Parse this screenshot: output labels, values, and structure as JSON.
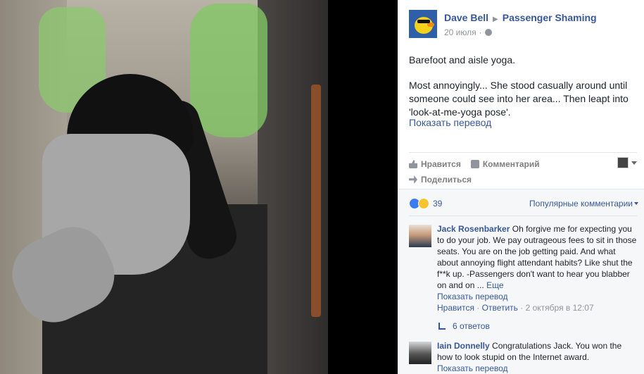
{
  "post": {
    "author": "Dave Bell",
    "group": "Passenger Shaming",
    "date": "20 июля",
    "privacy_icon": "globe-icon",
    "text_lines": [
      "Barefoot and aisle yoga.",
      "Most annoyingly... She stood casually around until someone could see into her area... Then leapt into 'look-at-me-yoga pose'."
    ],
    "translate_label": "Показать перевод"
  },
  "actions": {
    "like": "Нравится",
    "comment": "Комментарий",
    "share": "Поделиться"
  },
  "reactions": {
    "count": "39",
    "sort_label": "Популярные комментарии"
  },
  "comments": [
    {
      "author": "Jack Rosenbarker",
      "text": "Oh forgive me for expecting you to do your job. We pay outrageous fees to sit in those seats. You are on the job getting paid. And what about annoying flight attendant habits? Like shut the f**k up. -Passengers don't want to hear you blabber on and on ...",
      "more": "Еще",
      "translate": "Показать перевод",
      "like": "Нравится",
      "reply": "Ответить",
      "time": "2 октября в 12:07",
      "replies": "6 ответов"
    },
    {
      "author": "Iain Donnelly",
      "text": "Congratulations Jack. You won the how to look stupid on the Internet award.",
      "translate": "Показать перевод"
    }
  ],
  "colors": {
    "link": "#365899",
    "meta": "#90949c",
    "panel_bg": "#ffffff",
    "comments_bg": "#f6f7f9",
    "photo_bg": "#000000"
  }
}
